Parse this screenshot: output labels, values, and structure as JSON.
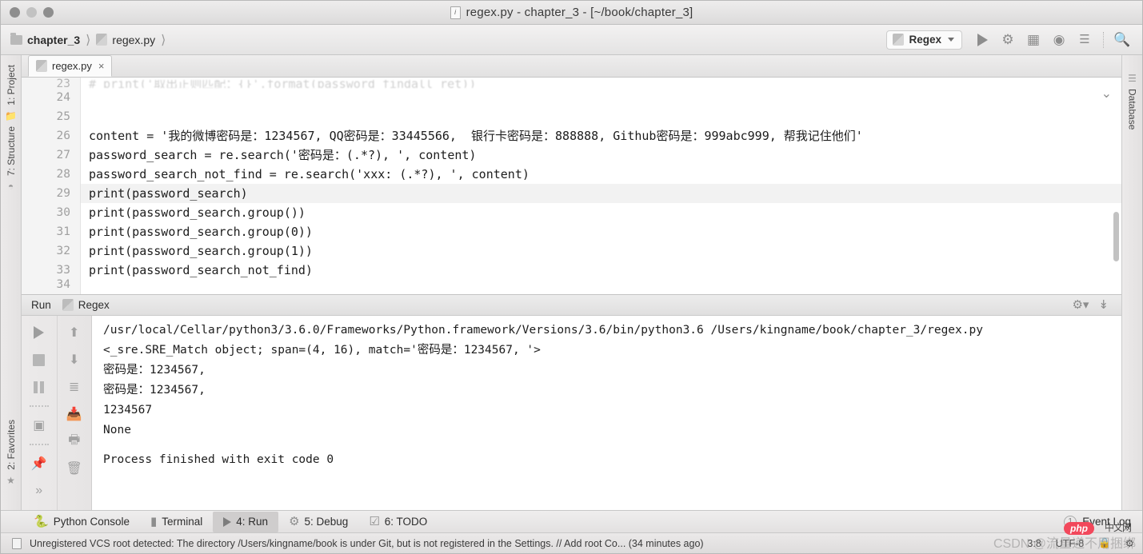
{
  "window": {
    "title": "regex.py - chapter_3 - [~/book/chapter_3]",
    "file_icon": "python-file-icon"
  },
  "breadcrumb": {
    "items": [
      {
        "label": "chapter_3",
        "icon": "folder-icon"
      },
      {
        "label": "regex.py",
        "icon": "python-file-icon"
      }
    ]
  },
  "toolbar": {
    "run_config": "Regex",
    "buttons": [
      {
        "name": "run-button",
        "icon": "play-icon"
      },
      {
        "name": "debug-button",
        "icon": "bug-icon"
      },
      {
        "name": "coverage-button",
        "icon": "coverage-icon"
      },
      {
        "name": "profile-button",
        "icon": "profile-icon"
      },
      {
        "name": "run-with-console-button",
        "icon": "run-list-icon"
      },
      {
        "name": "search-button",
        "icon": "search-icon"
      }
    ]
  },
  "left_rail": {
    "items": [
      {
        "label": "1: Project",
        "icon": "project-icon"
      },
      {
        "label": "7: Structure",
        "icon": "structure-icon"
      },
      {
        "label": "2: Favorites",
        "icon": "star-icon"
      }
    ]
  },
  "right_rail": {
    "items": [
      {
        "label": "Database",
        "icon": "database-icon"
      }
    ]
  },
  "editor": {
    "tab": {
      "label": "regex.py",
      "close": "×",
      "icon": "python-file-icon"
    },
    "lines": [
      {
        "num": "23",
        "text": "# print('取出正则匹配：{}'.format(password_findall_ret))",
        "blurred": true
      },
      {
        "num": "24",
        "text": "",
        "blurred": false
      },
      {
        "num": "25",
        "text": "",
        "blurred": false
      },
      {
        "num": "26",
        "text": "content = '我的微博密码是：1234567, QQ密码是：33445566,  银行卡密码是：888888, Github密码是：999abc999, 帮我记住他们'",
        "blurred": false
      },
      {
        "num": "27",
        "text": "password_search = re.search('密码是：(.*?), ', content)",
        "blurred": false
      },
      {
        "num": "28",
        "text": "password_search_not_find = re.search('xxx: (.*?), ', content)",
        "blurred": false
      },
      {
        "num": "29",
        "text": "print(password_search)",
        "blurred": false,
        "highlight": true
      },
      {
        "num": "30",
        "text": "print(password_search.group())",
        "blurred": false
      },
      {
        "num": "31",
        "text": "print(password_search.group(0))",
        "blurred": false
      },
      {
        "num": "32",
        "text": "print(password_search.group(1))",
        "blurred": false
      },
      {
        "num": "33",
        "text": "print(password_search_not_find)",
        "blurred": false
      },
      {
        "num": "34",
        "text": "",
        "blurred": true
      }
    ]
  },
  "run_panel": {
    "title": "Run",
    "config_tab": "Regex",
    "tools_left": [
      {
        "name": "rerun-button",
        "icon": "play-icon"
      },
      {
        "name": "stop-button",
        "icon": "stop-icon"
      },
      {
        "name": "pause-button",
        "icon": "pause-icon"
      },
      {
        "name": "layout-button",
        "icon": "layout-icon"
      },
      {
        "name": "pin-button",
        "icon": "pin-icon"
      },
      {
        "name": "more-button",
        "icon": "chevron-right-icon"
      }
    ],
    "tools_right": [
      {
        "name": "prev-occurrence-button",
        "icon": "arrow-up-icon"
      },
      {
        "name": "next-occurrence-button",
        "icon": "arrow-down-icon"
      },
      {
        "name": "soft-wrap-button",
        "icon": "filter-icon"
      },
      {
        "name": "export-button",
        "icon": "export-icon"
      },
      {
        "name": "print-button",
        "icon": "print-icon"
      },
      {
        "name": "clear-all-button",
        "icon": "trash-icon"
      }
    ],
    "header_right": [
      {
        "name": "settings-button",
        "icon": "gear-icon"
      },
      {
        "name": "scroll-to-end-button",
        "icon": "scroll-end-icon"
      }
    ],
    "output": [
      "/usr/local/Cellar/python3/3.6.0/Frameworks/Python.framework/Versions/3.6/bin/python3.6 /Users/kingname/book/chapter_3/regex.py",
      "<_sre.SRE_Match object; span=(4, 16), match='密码是：1234567, '>",
      "密码是：1234567,",
      "密码是：1234567,",
      "1234567",
      "None",
      "",
      "Process finished with exit code 0"
    ]
  },
  "bottom_tabs": {
    "items": [
      {
        "label": "Python Console",
        "mnemonic": "",
        "icon": "python-console-icon",
        "active": false
      },
      {
        "label": "Terminal",
        "mnemonic": "",
        "icon": "terminal-icon",
        "active": false
      },
      {
        "label": "4: Run",
        "mnemonic": "4",
        "icon": "play-icon",
        "active": true
      },
      {
        "label": "5: Debug",
        "mnemonic": "5",
        "icon": "bug-icon",
        "active": false
      },
      {
        "label": "6: TODO",
        "mnemonic": "6",
        "icon": "todo-icon",
        "active": false
      }
    ],
    "event_log": {
      "label": "Event Log",
      "badge": "1",
      "icon": "event-log-icon"
    }
  },
  "statusbar": {
    "message": "Unregistered VCS root detected: The directory /Users/kingname/book is under Git, but is not registered in the Settings. // Add root  Co... (34 minutes ago)",
    "caret_position": "3:8",
    "encoding": "UTF-8",
    "lock_icon": "lock-icon",
    "vcs_icon": "vcs-icon"
  },
  "watermark": {
    "text": "CSDN @流量递不用捆绑",
    "php_badge": "php",
    "cn_badge": "中文网"
  },
  "colors": {
    "accent": "#f2485b",
    "chrome": "#eceaea",
    "editor_bg": "#ffffff"
  }
}
